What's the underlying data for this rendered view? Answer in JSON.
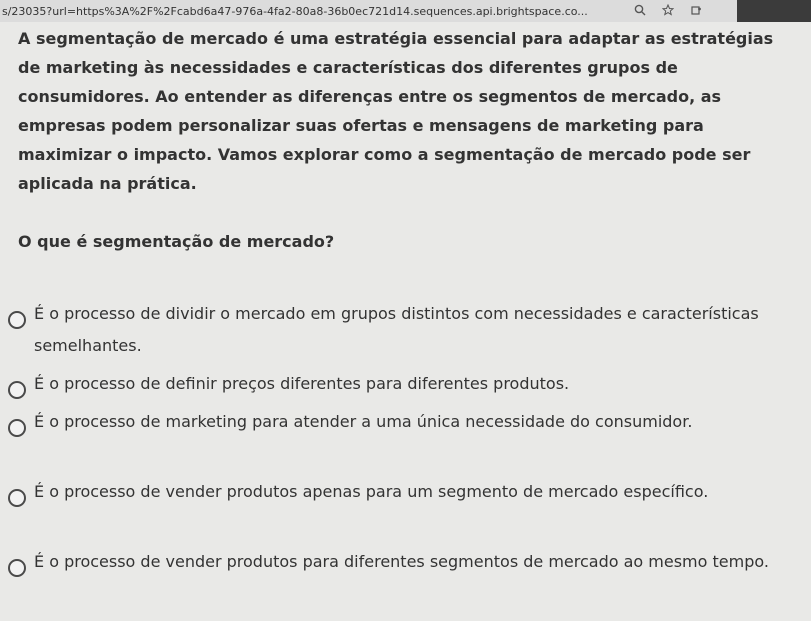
{
  "browser": {
    "url": "s/23035?url=https%3A%2F%2Fcabd6a47-976a-4fa2-80a8-36b0ec721d14.sequences.api.brightspace.co...",
    "icons": [
      "search-icon",
      "star-icon",
      "extension-icon"
    ]
  },
  "content": {
    "intro": "A segmentação de mercado é uma estratégia essencial para adaptar as estratégias de marketing às necessidades e características dos diferentes grupos de consumidores. Ao entender as diferenças entre os segmentos de mercado, as empresas podem personalizar suas ofertas e mensagens de marketing para maximizar o impacto. Vamos explorar como a segmentação de mercado pode ser aplicada na prática.",
    "question": "O que é segmentação de mercado?",
    "options": [
      {
        "label": "É o processo de dividir o mercado em grupos distintos com necessidades e características semelhantes."
      },
      {
        "label": "É o processo de definir preços diferentes para diferentes produtos."
      },
      {
        "label": "É o processo de marketing para atender a uma única necessidade do consumidor."
      },
      {
        "label": "É o processo de vender produtos apenas para um segmento de mercado específico."
      },
      {
        "label": "É o processo de vender produtos para diferentes segmentos de mercado ao mesmo tempo."
      }
    ]
  }
}
